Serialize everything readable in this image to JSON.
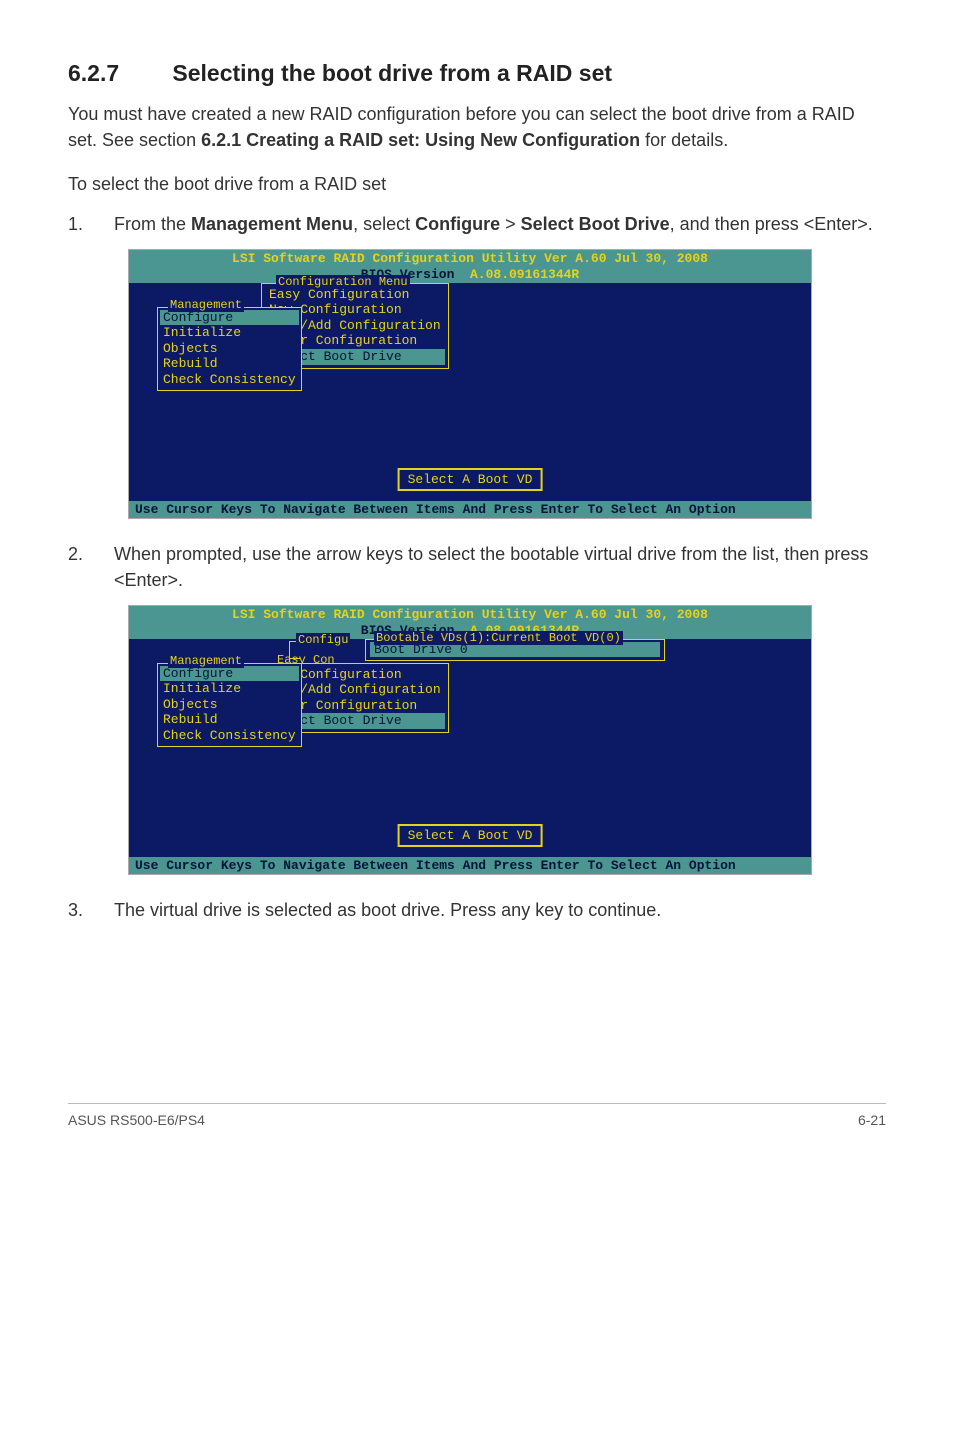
{
  "heading": {
    "number": "6.2.7",
    "title": "Selecting the boot drive from a RAID set"
  },
  "intro": {
    "p1_a": "You must have created a new RAID configuration before you can select the boot drive from a RAID set. See section ",
    "p1_b": "6.2.1 Creating a RAID set: Using New Configuration",
    "p1_c": " for details.",
    "p2": "To select the boot drive from a RAID set"
  },
  "steps": {
    "s1": {
      "num": "1.",
      "a": "From the ",
      "b": "Management Menu",
      "c": ", select ",
      "d": "Configure",
      "e": " > ",
      "f": "Select Boot Drive",
      "g": ", and then press <Enter>."
    },
    "s2": {
      "num": "2.",
      "text": "When prompted, use the arrow keys to select the bootable virtual drive from the list, then press <Enter>."
    },
    "s3": {
      "num": "3.",
      "text": "The virtual drive is selected as boot drive. Press any key to continue."
    }
  },
  "bios": {
    "header_line1": "LSI Software RAID Configuration Utility Ver A.60 Jul 30, 2008",
    "header_line2_label": "BIOS Version",
    "header_line2_value": "A.08.09161344R",
    "mgmt_label": "Management",
    "mgmt_items": [
      "Configure",
      "Initialize",
      "Objects",
      "Rebuild",
      "Check Consistency"
    ],
    "config_label": "Configuration Menu",
    "config_items": [
      "Easy Configuration",
      "New Configuration",
      "View/Add Configuration",
      "Clear Configuration",
      "Select Boot Drive"
    ],
    "status_text": "Select A Boot VD",
    "footer_text": "Use Cursor Keys To Navigate Between Items And Press Enter To Select An Option",
    "boot_popup_label": "Bootable VDs(1):Current Boot VD(0)",
    "boot_popup_item": "Boot Drive 0",
    "easycon_text": "Easy Con",
    "configu_text": "Configu"
  },
  "footer": {
    "left": "ASUS RS500-E6/PS4",
    "right": "6-21"
  }
}
